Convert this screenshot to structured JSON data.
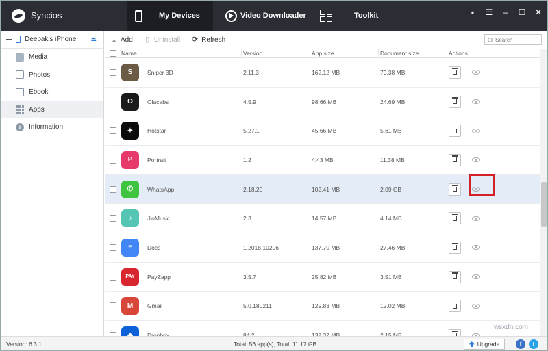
{
  "titlebar": {
    "app_name": "Syncios",
    "tabs": [
      {
        "label": "My Devices"
      },
      {
        "label": "Video Downloader"
      },
      {
        "label": "Toolkit"
      }
    ],
    "controls": [
      "message",
      "menu",
      "minimize",
      "maximize",
      "close"
    ]
  },
  "sidebar": {
    "device_name": "Deepak's iPhone",
    "items": [
      {
        "label": "Media",
        "icon": "media-icon"
      },
      {
        "label": "Photos",
        "icon": "photos-icon"
      },
      {
        "label": "Ebook",
        "icon": "ebook-icon"
      },
      {
        "label": "Apps",
        "icon": "apps-icon",
        "active": true
      },
      {
        "label": "Information",
        "icon": "information-icon"
      }
    ]
  },
  "toolbar": {
    "add_label": "Add",
    "uninstall_label": "Uninstall",
    "refresh_label": "Refresh",
    "search_placeholder": "Search"
  },
  "table": {
    "columns": [
      "Name",
      "Version",
      "App size",
      "Document size",
      "Actions"
    ],
    "rows": [
      {
        "name": "Sniper 3D",
        "version": "2.11.3",
        "app_size": "162.12 MB",
        "doc_size": "79.38 MB",
        "icon_color": "#6b5a44",
        "glyph": "S"
      },
      {
        "name": "Olacabs",
        "version": "4.5.9",
        "app_size": "98.66 MB",
        "doc_size": "24.69 MB",
        "icon_color": "#1a1a1a",
        "glyph": "O"
      },
      {
        "name": "Hotstar",
        "version": "5.27.1",
        "app_size": "45.66 MB",
        "doc_size": "5.61 MB",
        "icon_color": "#0b0b0b",
        "glyph": "✦"
      },
      {
        "name": "Portrait",
        "version": "1.2",
        "app_size": "4.43 MB",
        "doc_size": "11.38 MB",
        "icon_color": "#e63a6b",
        "glyph": "P"
      },
      {
        "name": "WhatsApp",
        "version": "2.18.20",
        "app_size": "102.41 MB",
        "doc_size": "2.09 GB",
        "icon_color": "#3ec43f",
        "glyph": "✆",
        "selected": true
      },
      {
        "name": "JioMusic",
        "version": "2.3",
        "app_size": "14.57 MB",
        "doc_size": "4.14 MB",
        "icon_color": "#56c6b4",
        "glyph": "♪"
      },
      {
        "name": "Docs",
        "version": "1.2018.10206",
        "app_size": "137.70 MB",
        "doc_size": "27.46 MB",
        "icon_color": "#4285f4",
        "glyph": "≡"
      },
      {
        "name": "PayZapp",
        "version": "3.5.7",
        "app_size": "25.82 MB",
        "doc_size": "3.51 MB",
        "icon_color": "#d7262e",
        "glyph": "PAY"
      },
      {
        "name": "Gmail",
        "version": "5.0.180211",
        "app_size": "129.83 MB",
        "doc_size": "12.02 MB",
        "icon_color": "#d8463a",
        "glyph": "M"
      },
      {
        "name": "Dropbox",
        "version": "84.2",
        "app_size": "137.37 MB",
        "doc_size": "2.15 MB",
        "icon_color": "#0d62d9",
        "glyph": "◆"
      }
    ]
  },
  "statusbar": {
    "version": "Version: 6.3.1",
    "total": "Total: 56 app(s), Total: 11.17 GB",
    "upgrade_label": "Upgrade"
  },
  "watermark": "wsxdn.com",
  "colors": {
    "titlebar_bg": "#2a2d34",
    "active_tab_bg": "#1c1e23",
    "selected_row": "#e4ecf7",
    "highlight_box": "#d42027",
    "accent": "#2e7dd7"
  }
}
